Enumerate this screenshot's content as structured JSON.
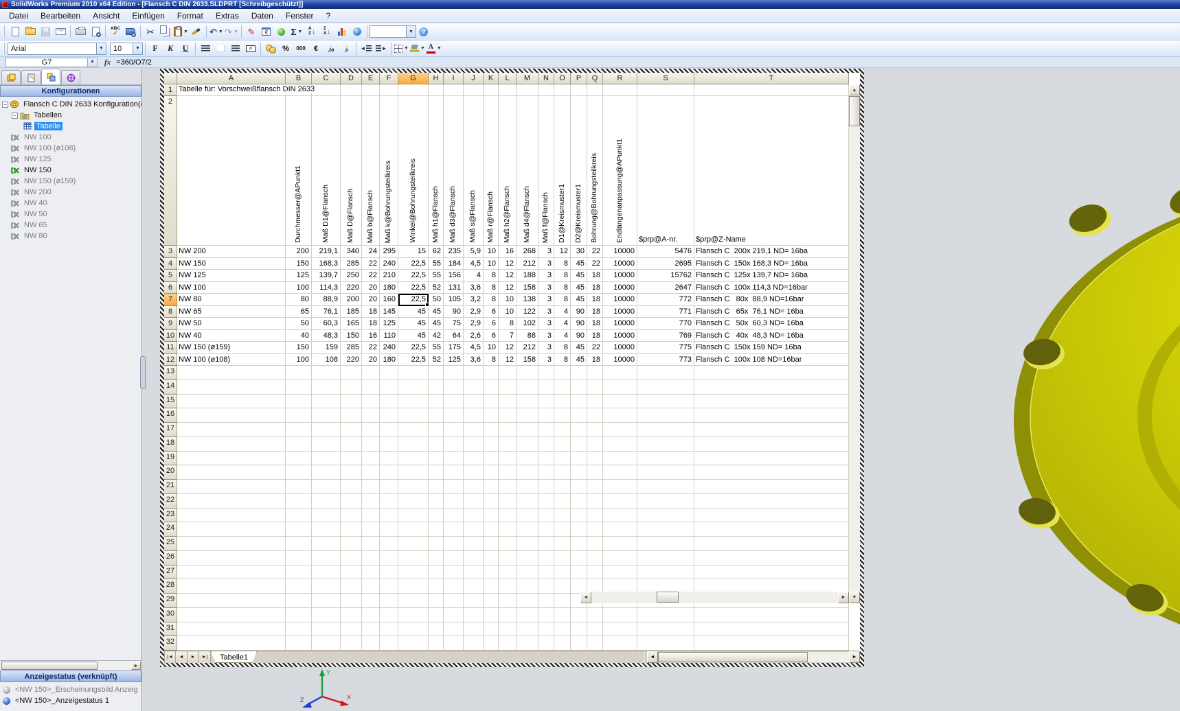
{
  "window": {
    "title": "SolidWorks Premium 2010 x64 Edition - [Flansch C DIN 2633.SLDPRT [Schreibgeschützt]]"
  },
  "menu": {
    "items": [
      "Datei",
      "Bearbeiten",
      "Ansicht",
      "Einfügen",
      "Format",
      "Extras",
      "Daten",
      "Fenster",
      "?"
    ]
  },
  "toolbar_std": {
    "spelling_label": "ABC",
    "sum_label": "Σ",
    "sort_az": "AZ",
    "sort_za": "ZA",
    "zoom_value": "",
    "help_label": "?"
  },
  "toolbar_fmt": {
    "font_name": "Arial",
    "font_size": "10",
    "bold": "F",
    "italic": "K",
    "underline": "U",
    "percent": "%",
    "thousands": "000",
    "euro": "€",
    "dec_inc_label": ",00",
    "dec_dec_label": ",0",
    "merge_label": "a",
    "font_color_label": "A"
  },
  "formula_bar": {
    "cell_ref": "G7",
    "fx_label": "fx",
    "formula": "=360/O7/2"
  },
  "left_panel": {
    "tabs": [
      "part-icon",
      "properties-icon",
      "configurations-icon",
      "dimxpert-icon"
    ],
    "config_header": "Konfigurationen",
    "tree_root": "Flansch C DIN 2633 Konfiguration(e",
    "folder_label": "Tabellen",
    "table_label": "Tabelle",
    "configs": [
      {
        "label": "NW 100",
        "active": false
      },
      {
        "label": "NW 100 (ø108)",
        "active": false
      },
      {
        "label": "NW 125",
        "active": false
      },
      {
        "label": "NW 150",
        "active": true
      },
      {
        "label": "NW 150 (ø159)",
        "active": false
      },
      {
        "label": "NW 200",
        "active": false
      },
      {
        "label": "NW 40",
        "active": false
      },
      {
        "label": "NW 50",
        "active": false
      },
      {
        "label": "NW 65",
        "active": false
      },
      {
        "label": "NW 80",
        "active": false
      }
    ],
    "display_header": "Anzeigestatus (verknüpft)",
    "display_items": [
      {
        "label": "<NW 150>_Erscheinungsbild Anzeig",
        "muted": true
      },
      {
        "label": "<NW 150>_Anzeigestatus 1",
        "muted": false
      }
    ]
  },
  "spreadsheet": {
    "title_cell": "Tabelle für: Vorschweißflansch DIN 2633",
    "columns": [
      "A",
      "B",
      "C",
      "D",
      "E",
      "F",
      "G",
      "H",
      "I",
      "J",
      "K",
      "L",
      "M",
      "N",
      "O",
      "P",
      "Q",
      "R",
      "S",
      "T"
    ],
    "selected_column": "G",
    "selected_row_number": 7,
    "selected_cell": "G7",
    "rotated_headers": [
      "Durchmesser@APunkt1",
      "Maß D1@Flansch",
      "Maß D@Flansch",
      "Maß b@Flansch",
      "Maß k@Bohrungsteilkreis",
      "Winkel@Bohrungsteilkreis",
      "Maß h1@Flansch",
      "Maß d3@Flansch",
      "Maß s@Flansch",
      "Maß r@Flansch",
      "Maß h2@Flansch",
      "Maß d4@Flansch",
      "Maß f@Flansch",
      "D1@Kreismuster1",
      "D2@Kreismuster1",
      "Bohrung@Bohrungsteilkreis",
      "Endlängenanpassung@APunkt1"
    ],
    "header_s": "$prp@A-nr.",
    "header_t": "$prp@Z-Name",
    "rows": [
      {
        "n": 3,
        "cells": [
          "NW 200",
          "200",
          "219,1",
          "340",
          "24",
          "295",
          "15",
          "62",
          "235",
          "5,9",
          "10",
          "16",
          "268",
          "3",
          "12",
          "30",
          "22",
          "10000",
          "5476",
          "Flansch C  200x 219,1 ND= 16ba"
        ]
      },
      {
        "n": 4,
        "cells": [
          "NW 150",
          "150",
          "168,3",
          "285",
          "22",
          "240",
          "22,5",
          "55",
          "184",
          "4,5",
          "10",
          "12",
          "212",
          "3",
          "8",
          "45",
          "22",
          "10000",
          "2695",
          "Flansch C  150x 168,3 ND= 16ba"
        ]
      },
      {
        "n": 5,
        "cells": [
          "NW 125",
          "125",
          "139,7",
          "250",
          "22",
          "210",
          "22,5",
          "55",
          "156",
          "4",
          "8",
          "12",
          "188",
          "3",
          "8",
          "45",
          "18",
          "10000",
          "15762",
          "Flansch C  125x 139,7 ND= 16ba"
        ]
      },
      {
        "n": 6,
        "cells": [
          "NW 100",
          "100",
          "114,3",
          "220",
          "20",
          "180",
          "22,5",
          "52",
          "131",
          "3,6",
          "8",
          "12",
          "158",
          "3",
          "8",
          "45",
          "18",
          "10000",
          "2647",
          "Flansch C  100x 114,3 ND=16bar"
        ]
      },
      {
        "n": 7,
        "cells": [
          "NW 80",
          "80",
          "88,9",
          "200",
          "20",
          "160",
          "22,5",
          "50",
          "105",
          "3,2",
          "8",
          "10",
          "138",
          "3",
          "8",
          "45",
          "18",
          "10000",
          "772",
          "Flansch C   80x  88,9 ND=16bar"
        ]
      },
      {
        "n": 8,
        "cells": [
          "NW 65",
          "65",
          "76,1",
          "185",
          "18",
          "145",
          "45",
          "45",
          "90",
          "2,9",
          "6",
          "10",
          "122",
          "3",
          "4",
          "90",
          "18",
          "10000",
          "771",
          "Flansch C   65x  76,1 ND= 16ba"
        ]
      },
      {
        "n": 9,
        "cells": [
          "NW 50",
          "50",
          "60,3",
          "165",
          "18",
          "125",
          "45",
          "45",
          "75",
          "2,9",
          "6",
          "8",
          "102",
          "3",
          "4",
          "90",
          "18",
          "10000",
          "770",
          "Flansch C   50x  60,3 ND= 16ba"
        ]
      },
      {
        "n": 10,
        "cells": [
          "NW 40",
          "40",
          "48,3",
          "150",
          "16",
          "110",
          "45",
          "42",
          "64",
          "2,6",
          "6",
          "7",
          "88",
          "3",
          "4",
          "90",
          "18",
          "10000",
          "769",
          "Flansch C   40x  48,3 ND= 16ba"
        ]
      },
      {
        "n": 11,
        "cells": [
          "NW 150 (ø159)",
          "150",
          "159",
          "285",
          "22",
          "240",
          "22,5",
          "55",
          "175",
          "4,5",
          "10",
          "12",
          "212",
          "3",
          "8",
          "45",
          "22",
          "10000",
          "775",
          "Flansch C  150x 159 ND= 16ba"
        ]
      },
      {
        "n": 12,
        "cells": [
          "NW 100 (ø108)",
          "100",
          "108",
          "220",
          "20",
          "180",
          "22,5",
          "52",
          "125",
          "3,6",
          "8",
          "12",
          "158",
          "3",
          "8",
          "45",
          "18",
          "10000",
          "773",
          "Flansch C  100x 108 ND=16bar"
        ]
      }
    ],
    "last_row_number": 32,
    "sheet_tab": "Tabelle1"
  },
  "viewport": {
    "flange_color": "#d6d40a",
    "flange_dark": "#8e8f04",
    "confirm_color": "#46b41e",
    "triad": {
      "x_label": "X",
      "y_label": "Y",
      "z_label": "Z"
    }
  }
}
